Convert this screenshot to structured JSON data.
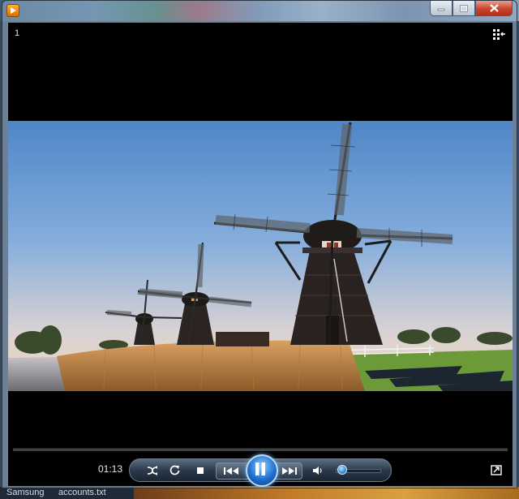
{
  "window": {
    "app_icon": "media-player-app-icon",
    "caption_buttons": [
      "minimize-icon",
      "maximize-icon",
      "close-icon"
    ]
  },
  "player": {
    "track_number": "1",
    "switch_to_library_icon": "switch-to-library-icon",
    "video_scene": "windmills-at-dusk",
    "elapsed_time": "01:13",
    "seek_progress": 0.0,
    "volume_level": 0.06,
    "controls": [
      "shuffle-icon",
      "repeat-icon",
      "stop-icon",
      "previous-icon",
      "pause-icon",
      "next-icon",
      "volume-icon"
    ],
    "fullscreen_icon": "fullscreen-icon"
  },
  "taskbar": {
    "items": [
      "Samsung",
      "accounts.txt"
    ]
  },
  "colors": {
    "player_background": "#000000",
    "accent_blue": "#1e6fd0",
    "close_red": "#c8432c"
  }
}
